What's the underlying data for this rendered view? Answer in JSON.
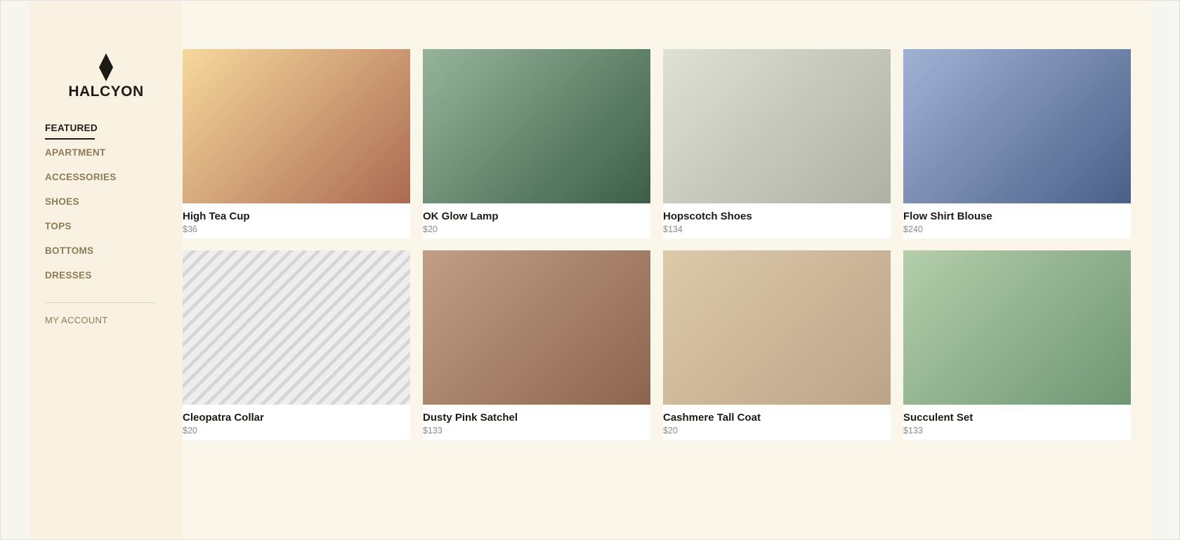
{
  "brand": {
    "name": "HALCYON",
    "logo_icon": "diamond-icon"
  },
  "nav": {
    "items": [
      {
        "label": "FEATURED",
        "active": true
      },
      {
        "label": "APARTMENT",
        "active": false
      },
      {
        "label": "ACCESSORIES",
        "active": false
      },
      {
        "label": "SHOES",
        "active": false
      },
      {
        "label": "TOPS",
        "active": false
      },
      {
        "label": "BOTTOMS",
        "active": false
      },
      {
        "label": "DRESSES",
        "active": false
      }
    ],
    "account_label": "MY ACCOUNT"
  },
  "products": [
    {
      "name": "High Tea Cup",
      "price": "$36",
      "gradient": [
        "#f7d89c",
        "#ab6a52"
      ]
    },
    {
      "name": "OK Glow Lamp",
      "price": "$20",
      "gradient": [
        "#96b49a",
        "#3c5e48"
      ]
    },
    {
      "name": "Hopscotch Shoes",
      "price": "$134",
      "gradient": [
        "#dfe0d6",
        "#aeb1a3"
      ]
    },
    {
      "name": "Flow Shirt Blouse",
      "price": "$240",
      "gradient": [
        "#a0b2d4",
        "#4c5f88"
      ]
    },
    {
      "name": "Cleopatra Collar",
      "price": "$20",
      "pattern": "diagonal-stripes",
      "gradient": [
        "#eeeeee",
        "#d6d6d6"
      ]
    },
    {
      "name": "Dusty Pink Satchel",
      "price": "$133",
      "gradient": [
        "#c29e85",
        "#8c6550"
      ]
    },
    {
      "name": "Cashmere Tall Coat",
      "price": "$20",
      "gradient": [
        "#dccaaa",
        "#bca488"
      ]
    },
    {
      "name": "Succulent Set",
      "price": "$133",
      "gradient": [
        "#b4ceaa",
        "#6f9674"
      ]
    }
  ],
  "colors": {
    "page_background": "#fbf6ea",
    "sidebar_background": "#f9f1e1",
    "nav_text": "#8d7c58",
    "nav_active": "#1e1b16"
  }
}
